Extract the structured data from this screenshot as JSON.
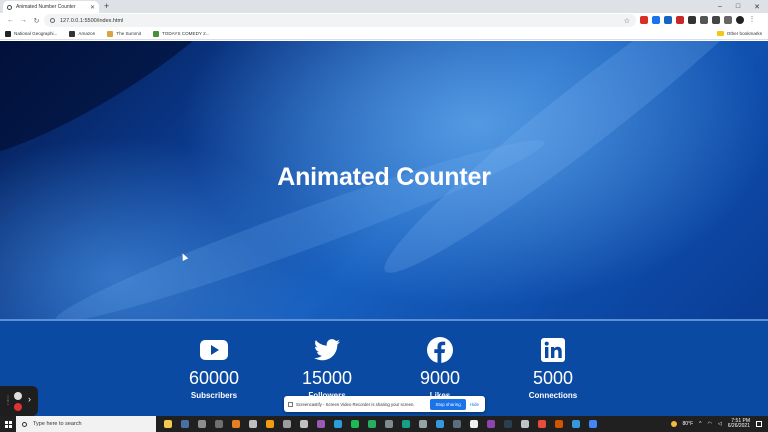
{
  "browser": {
    "tab_title": "Animated Number Counter",
    "new_tab": "+",
    "url": "127.0.0.1:5500/index.html",
    "window_controls": [
      "–",
      "□",
      "✕"
    ],
    "bookmarks": [
      {
        "label": "National Geographi...",
        "color": "#222222"
      },
      {
        "label": "Amazon",
        "color": "#333333"
      },
      {
        "label": "The Summit",
        "color": "#d9a441"
      },
      {
        "label": "TODAYS COMEDY 2...",
        "color": "#4a8f3c"
      }
    ],
    "other_bookmarks": "Other bookmarks"
  },
  "hero": {
    "title": "Animated Counter"
  },
  "counters": [
    {
      "icon": "youtube-icon",
      "value": "60000",
      "label": "Subscribers"
    },
    {
      "icon": "twitter-icon",
      "value": "15000",
      "label": "Followers"
    },
    {
      "icon": "facebook-icon",
      "value": "9000",
      "label": "Likes"
    },
    {
      "icon": "linkedin-icon",
      "value": "5000",
      "label": "Connections"
    }
  ],
  "share_bar": {
    "text": "Screencastify - Screen Video Recorder is sharing your screen.",
    "stop_label": "Stop sharing",
    "hide_label": "Hide"
  },
  "taskbar": {
    "search_placeholder": "Type here to search",
    "weather": "80°F",
    "time": "7:51 PM",
    "date": "6/26/2021"
  },
  "colors": {
    "counter_bg": "#0a4aa3",
    "accent": "#1a73e8"
  }
}
